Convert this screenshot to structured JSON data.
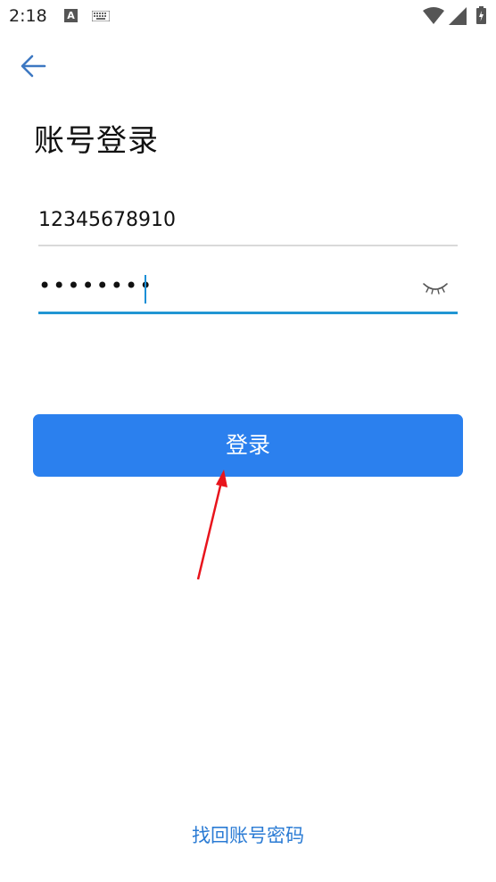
{
  "status_bar": {
    "time": "2:18",
    "a_icon_label": "A"
  },
  "header": {
    "title": "账号登录"
  },
  "form": {
    "username_value": "12345678910",
    "password_masked": "••••••••"
  },
  "buttons": {
    "login_label": "登录"
  },
  "footer": {
    "recover_label": "找回账号密码"
  },
  "colors": {
    "accent": "#2b80ee",
    "link": "#2a7bd4",
    "focus_underline": "#2196d3",
    "annotation_arrow": "#e8141c"
  }
}
